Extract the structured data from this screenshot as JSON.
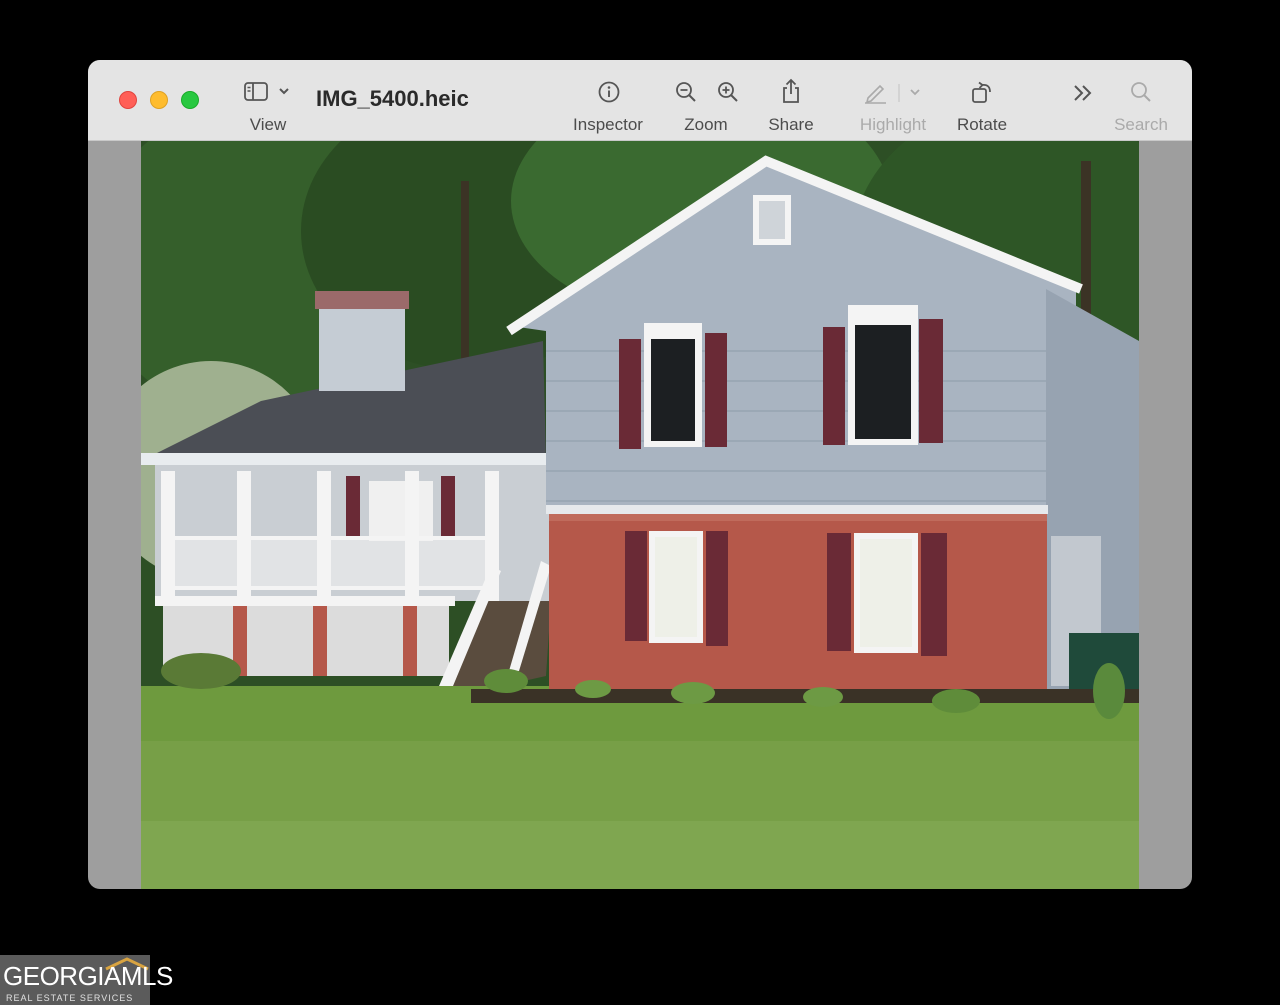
{
  "window": {
    "title": "IMG_5400.heic",
    "traffic_lights": {
      "close": "#ff5f57",
      "minimize": "#febc2e",
      "zoom": "#28c840"
    }
  },
  "toolbar": {
    "view_label": "View",
    "inspector_label": "Inspector",
    "zoom_label": "Zoom",
    "share_label": "Share",
    "highlight_label": "Highlight",
    "rotate_label": "Rotate",
    "search_label": "Search",
    "icons": [
      "sidebar-icon",
      "chevron-down-icon",
      "info-icon",
      "zoom-out-icon",
      "zoom-in-icon",
      "share-icon",
      "pencil-icon",
      "rotate-icon",
      "chevron-double-right-icon",
      "search-icon"
    ]
  },
  "image": {
    "subject": "house-photo",
    "colors": {
      "siding": "#a9b4c1",
      "brick": "#b5584a",
      "shutters": "#6a2a36",
      "roof": "#4b4e55",
      "lawn": "#6e9a3e",
      "trees": "#2f5a27"
    }
  },
  "watermark": {
    "brand": "GEORGIAMLS",
    "tagline": "REAL ESTATE SERVICES"
  }
}
